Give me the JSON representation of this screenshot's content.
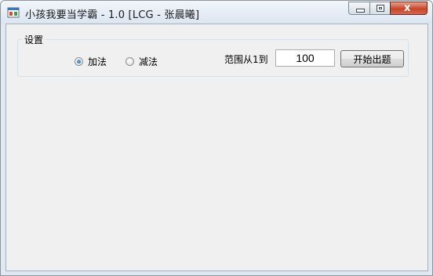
{
  "window": {
    "title": "小孩我要当学霸 - 1.0 [LCG - 张晨曦]",
    "controls": {
      "close_glyph": "x"
    }
  },
  "settings": {
    "group_label": "设置",
    "mode_options": [
      {
        "label": "加法",
        "selected": true
      },
      {
        "label": "减法",
        "selected": false
      }
    ],
    "range_label": "范围从1到",
    "range_value": "100",
    "start_button_label": "开始出题"
  },
  "colors": {
    "close_button": "#c6462a",
    "radio_selected": "#1c5a9a",
    "client_background": "#f0f0f0"
  }
}
